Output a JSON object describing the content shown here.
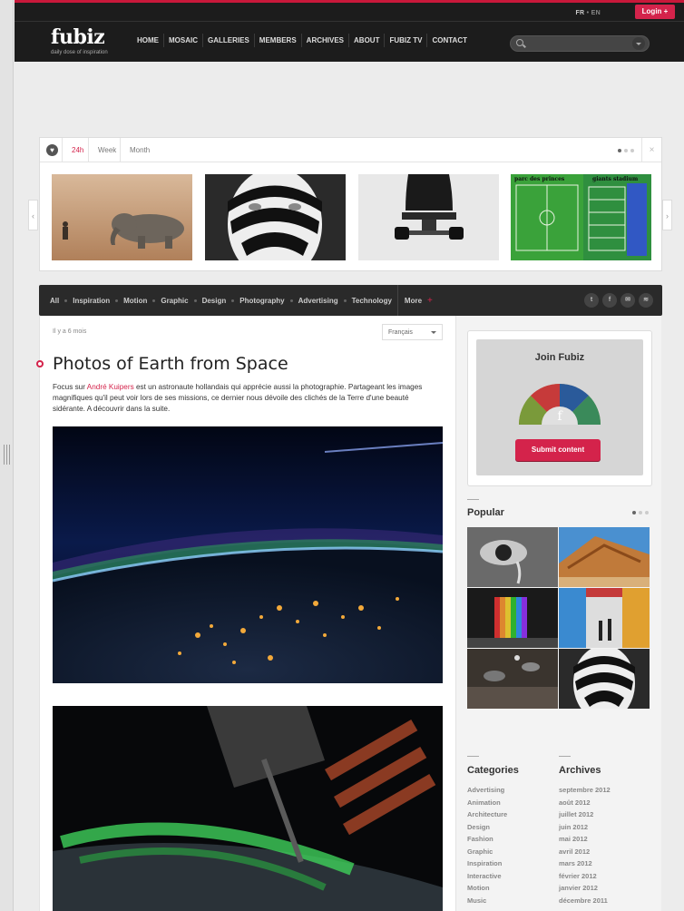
{
  "header": {
    "lang": {
      "fr": "FR",
      "sep": "•",
      "en": "EN"
    },
    "login_label": "Login +",
    "logo_text": "fubiz",
    "tagline": "daily dose of inspiration",
    "nav": [
      "HOME",
      "MOSAIC",
      "GALLERIES",
      "MEMBERS",
      "ARCHIVES",
      "ABOUT",
      "FUBIZ TV",
      "CONTACT"
    ],
    "search_icon": "search-icon"
  },
  "featured": {
    "tabs": [
      "24h",
      "Week",
      "Month"
    ],
    "active_tab": "24h",
    "close": "×",
    "thumbs": [
      "elephant-photo",
      "face-stripes-photo",
      "skateboard-photo",
      "stadium-photo"
    ],
    "stadium_labels": [
      "parc des princes",
      "giants stadium"
    ]
  },
  "categories": {
    "items": [
      "All",
      "Inspiration",
      "Motion",
      "Graphic",
      "Design",
      "Photography",
      "Advertising",
      "Technology"
    ],
    "more": "More",
    "more_plus": "+",
    "social": [
      "twitter-icon",
      "facebook-icon",
      "mail-icon",
      "rss-icon"
    ]
  },
  "article": {
    "meta": "Il y a 6 mois",
    "lang_select": "Français",
    "title": "Photos of Earth from Space",
    "body_before": "Focus sur ",
    "body_link": "André Kuipers",
    "body_after": " est un astronaute hollandais qui apprécie aussi la photographie. Partageant les images magnifiques qu'il peut voir lors de ses missions, ce dernier nous dévoile des clichés de la Terre d'une beauté sidérante. A découvrir dans la suite."
  },
  "sidebar": {
    "join_title": "Join Fubiz",
    "submit_label": "Submit content",
    "popular_title": "Popular",
    "categories_title": "Categories",
    "archives_title": "Archives",
    "category_list": [
      "Advertising",
      "Animation",
      "Architecture",
      "Design",
      "Fashion",
      "Graphic",
      "Inspiration",
      "Interactive",
      "Motion",
      "Music"
    ],
    "archive_list": [
      "septembre 2012",
      "août 2012",
      "juillet 2012",
      "juin 2012",
      "mai 2012",
      "avril 2012",
      "mars 2012",
      "février 2012",
      "janvier 2012",
      "décembre 2011"
    ]
  },
  "colors": {
    "accent": "#d4234b",
    "header_bg": "#1c1c1c",
    "catbar_bg": "#2a2a2a"
  }
}
